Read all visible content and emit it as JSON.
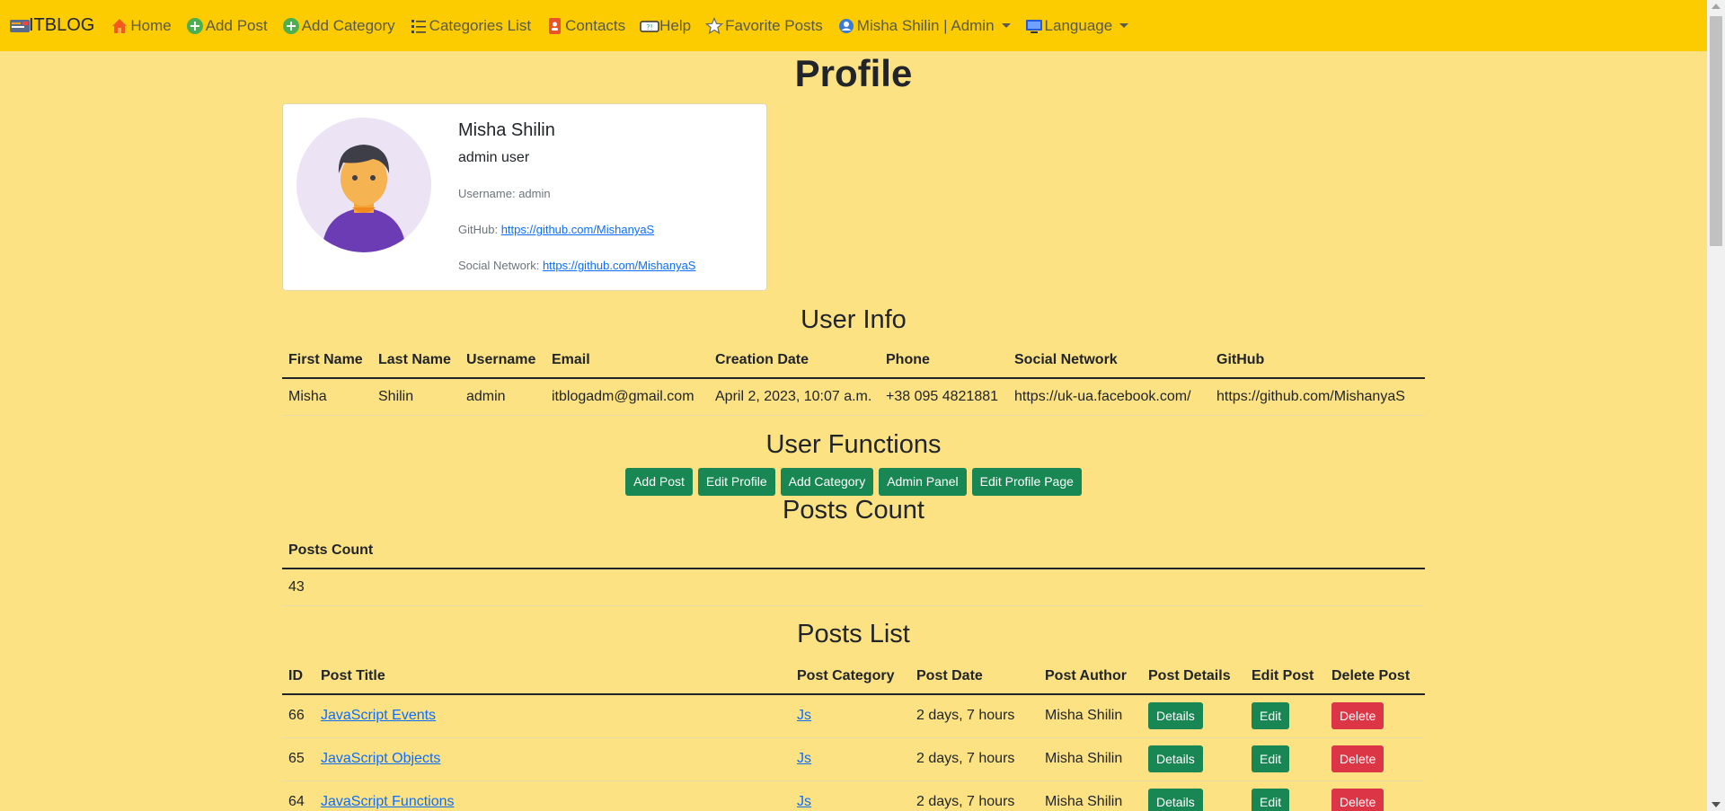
{
  "navbar": {
    "brand": "ITBLOG",
    "items": [
      {
        "label": "Home",
        "icon": "home-icon"
      },
      {
        "label": "Add Post",
        "icon": "plus-circle-icon"
      },
      {
        "label": "Add Category",
        "icon": "plus-circle-icon"
      },
      {
        "label": "Categories List",
        "icon": "list-icon"
      },
      {
        "label": "Contacts",
        "icon": "contacts-icon"
      },
      {
        "label": "Help",
        "icon": "help-icon"
      },
      {
        "label": "Favorite Posts",
        "icon": "star-icon"
      },
      {
        "label": "Misha Shilin | Admin",
        "icon": "user-icon"
      },
      {
        "label": "Language",
        "icon": "monitor-icon"
      }
    ]
  },
  "page_title": "Profile",
  "profile_card": {
    "name": "Misha Shilin",
    "role": "admin user",
    "username_label": "Username: admin",
    "github_label": "GitHub:",
    "github_link": "https://github.com/MishanyaS",
    "social_label": "Social Network:",
    "social_link": "https://github.com/MishanyaS"
  },
  "user_info": {
    "title": "User Info",
    "headers": [
      "First Name",
      "Last Name",
      "Username",
      "Email",
      "Creation Date",
      "Phone",
      "Social Network",
      "GitHub"
    ],
    "row": [
      "Misha",
      "Shilin",
      "admin",
      "itblogadm@gmail.com",
      "April 2, 2023, 10:07 a.m.",
      "+38 095 4821881",
      "https://uk-ua.facebook.com/",
      "https://github.com/MishanyaS"
    ]
  },
  "user_functions": {
    "title": "User Functions",
    "buttons": [
      "Add Post",
      "Edit Profile",
      "Add Category",
      "Admin Panel",
      "Edit Profile Page"
    ]
  },
  "posts_count": {
    "title": "Posts Count",
    "header": "Posts Count",
    "value": "43"
  },
  "posts_list": {
    "title": "Posts List",
    "headers": [
      "ID",
      "Post Title",
      "Post Category",
      "Post Date",
      "Post Author",
      "Post Details",
      "Edit Post",
      "Delete Post"
    ],
    "rows": [
      {
        "id": "66",
        "title": "JavaScript Events",
        "category": "Js",
        "date": "2 days, 7 hours",
        "author": "Misha Shilin",
        "details": "Details",
        "edit": "Edit",
        "delete": "Delete"
      },
      {
        "id": "65",
        "title": "JavaScript Objects",
        "category": "Js",
        "date": "2 days, 7 hours",
        "author": "Misha Shilin",
        "details": "Details",
        "edit": "Edit",
        "delete": "Delete"
      },
      {
        "id": "64",
        "title": "JavaScript Functions",
        "category": "Js",
        "date": "2 days, 7 hours",
        "author": "Misha Shilin",
        "details": "Details",
        "edit": "Edit",
        "delete": "Delete"
      }
    ]
  },
  "colors": {
    "navbar": "#fccb00",
    "background": "#fce282",
    "success": "#198754",
    "danger": "#dc3545",
    "link": "#0d6efd"
  }
}
